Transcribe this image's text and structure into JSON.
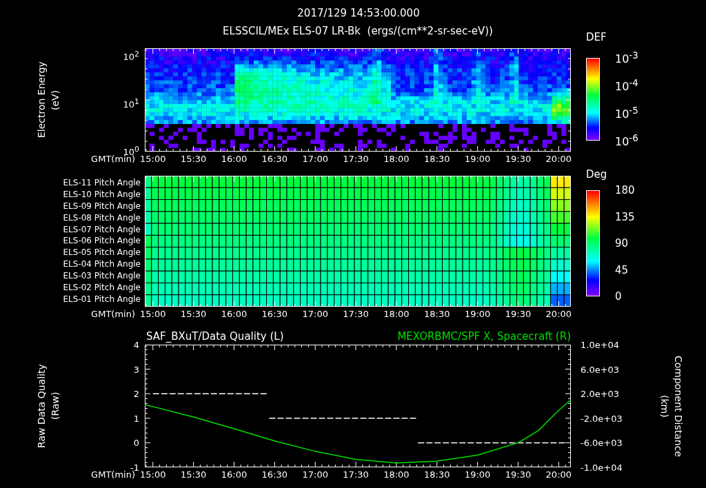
{
  "title": {
    "timestamp": "2017/129 14:53:00.000",
    "dataset": "ELSSCIL/MEx ELS-07 LR-Bk  (ergs/(cm**2-sr-sec-eV))"
  },
  "energy_panel": {
    "ylabel": "Electron Energy (eV)",
    "yticks": [
      "10$^{2}$",
      "10$^{1}$",
      "10$^{0}$"
    ],
    "xaxis_label": "GMT(min)",
    "xticks": [
      "15:00",
      "15:30",
      "16:00",
      "16:30",
      "17:00",
      "17:30",
      "18:00",
      "18:30",
      "19:00",
      "19:30",
      "20:00"
    ],
    "colorbar": {
      "title": "DEF",
      "ticks": [
        "10$^{-3}$",
        "10$^{-4}$",
        "10$^{-5}$",
        "10$^{-6}$"
      ]
    }
  },
  "pitch_panel": {
    "rows": [
      "ELS-11 Pitch Angle",
      "ELS-10 Pitch Angle",
      "ELS-09 Pitch Angle",
      "ELS-08 Pitch Angle",
      "ELS-07 Pitch Angle",
      "ELS-06 Pitch Angle",
      "ELS-05 Pitch Angle",
      "ELS-04 Pitch Angle",
      "ELS-03 Pitch Angle",
      "ELS-02 Pitch Angle",
      "ELS-01 Pitch Angle"
    ],
    "xaxis_label": "GMT(min)",
    "xticks": [
      "15:00",
      "15:30",
      "16:00",
      "16:30",
      "17:00",
      "17:30",
      "18:00",
      "18:30",
      "19:00",
      "19:30",
      "20:00"
    ],
    "colorbar": {
      "title": "Deg",
      "ticks": [
        "180",
        "135",
        "90",
        "45",
        "0"
      ]
    }
  },
  "line_panel": {
    "quality_plot": {
      "chart_data": {
        "type": "line",
        "ylabel": "Raw Data Quality (Raw)",
        "xlabel": "GMT(min)",
        "xlim": [
          894,
          1209
        ],
        "ylim": [
          -1,
          4
        ],
        "xticks": [
          {
            "value": 900,
            "label": "15:00"
          },
          {
            "value": 930,
            "label": "15:30"
          },
          {
            "value": 960,
            "label": "16:00"
          },
          {
            "value": 990,
            "label": "16:30"
          },
          {
            "value": 1020,
            "label": "17:00"
          },
          {
            "value": 1050,
            "label": "17:30"
          },
          {
            "value": 1080,
            "label": "18:00"
          },
          {
            "value": 1110,
            "label": "18:30"
          },
          {
            "value": 1140,
            "label": "19:00"
          },
          {
            "value": 1170,
            "label": "19:30"
          },
          {
            "value": 1200,
            "label": "20:00"
          }
        ],
        "yticks": [
          {
            "value": 4,
            "label": "4"
          },
          {
            "value": 3,
            "label": "3"
          },
          {
            "value": 2,
            "label": "2"
          },
          {
            "value": 1,
            "label": "1"
          },
          {
            "value": 0,
            "label": "0"
          },
          {
            "value": -1,
            "label": "-1"
          }
        ],
        "x": [
          900,
          985,
          986,
          1095,
          1096,
          1205
        ],
        "series": [
          {
            "name": "SAF_BXuT/Data Quality (L)",
            "color": "#ffffff",
            "line_style": "dashed",
            "values": [
              2,
              2,
              1,
              1,
              0,
              0
            ]
          }
        ]
      }
    },
    "distance_plot": {
      "chart_data": {
        "type": "line",
        "ylabel": "Component Distance (km)",
        "xlim": [
          894,
          1209
        ],
        "ylim": [
          -10000,
          10000
        ],
        "yticks": [
          {
            "value": 10000,
            "label": "1.0e+04"
          },
          {
            "value": 6000,
            "label": "6.0e+03"
          },
          {
            "value": 2000,
            "label": "2.0e+03"
          },
          {
            "value": -2000,
            "label": "-2.0e+03"
          },
          {
            "value": -6000,
            "label": "-6.0e+03"
          },
          {
            "value": -10000,
            "label": "-1.0e+04"
          }
        ],
        "x": [
          894,
          900,
          930,
          960,
          990,
          1020,
          1050,
          1080,
          1110,
          1140,
          1170,
          1185,
          1200,
          1209
        ],
        "series": [
          {
            "name": "MEXORBMC/SPF X, Spacecraft (R)",
            "color": "#00e000",
            "values": [
              200,
              -100,
              -1800,
              -3700,
              -5700,
              -7400,
              -8700,
              -9300,
              -9000,
              -8000,
              -6000,
              -4000,
              -700,
              1000
            ]
          }
        ]
      }
    }
  }
}
